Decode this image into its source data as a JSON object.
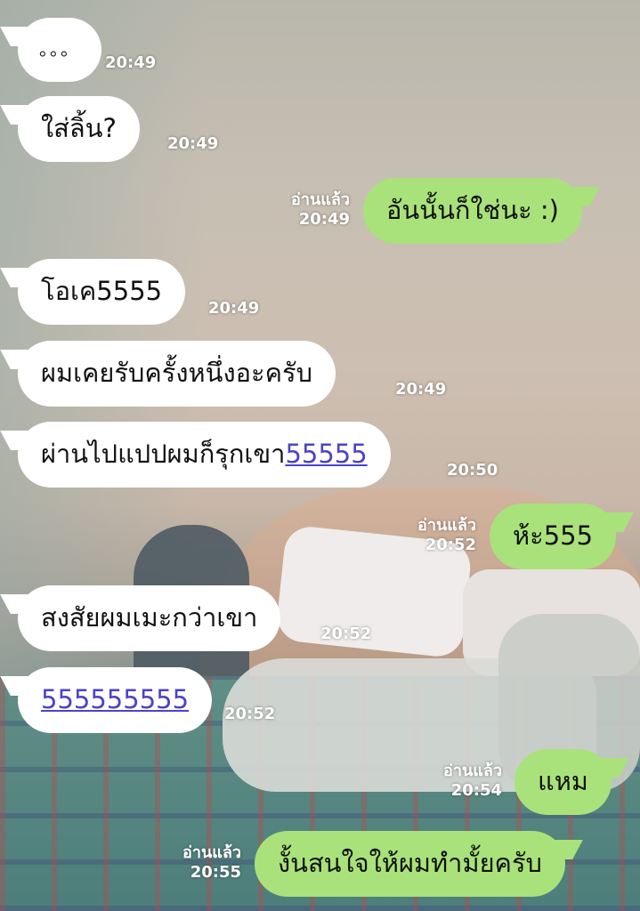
{
  "messages": [
    {
      "text": "。。。",
      "time": "20:49"
    },
    {
      "text": "ใส่ลิ้น?",
      "time": "20:49"
    },
    {
      "text": "อันนั้นก็ใช่นะ :)",
      "status": "อ่านแล้ว",
      "time": "20:49"
    },
    {
      "text": "โอเค5555",
      "time": "20:49"
    },
    {
      "text": "ผมเคยรับครั้งหนึ่งอะครับ",
      "time": "20:49"
    },
    {
      "text_prefix": "ผ่านไปแปปผมก็รุกเขา",
      "link": "55555",
      "time": "20:50"
    },
    {
      "text": "ห้ะ555",
      "status": "อ่านแล้ว",
      "time": "20:52"
    },
    {
      "text": "สงสัยผมเมะกว่าเขา",
      "time": "20:52"
    },
    {
      "link": "555555555",
      "time": "20:52"
    },
    {
      "text": "แหม",
      "status": "อ่านแล้ว",
      "time": "20:54"
    },
    {
      "text": "งั้นสนใจให้ผมทำมั้ยครับ",
      "status": "อ่านแล้ว",
      "time": "20:55"
    }
  ],
  "colors": {
    "incoming_bubble": "#ffffff",
    "outgoing_bubble": "#a9e27a",
    "link": "#4b43c8",
    "meta_text": "#ffffff"
  }
}
